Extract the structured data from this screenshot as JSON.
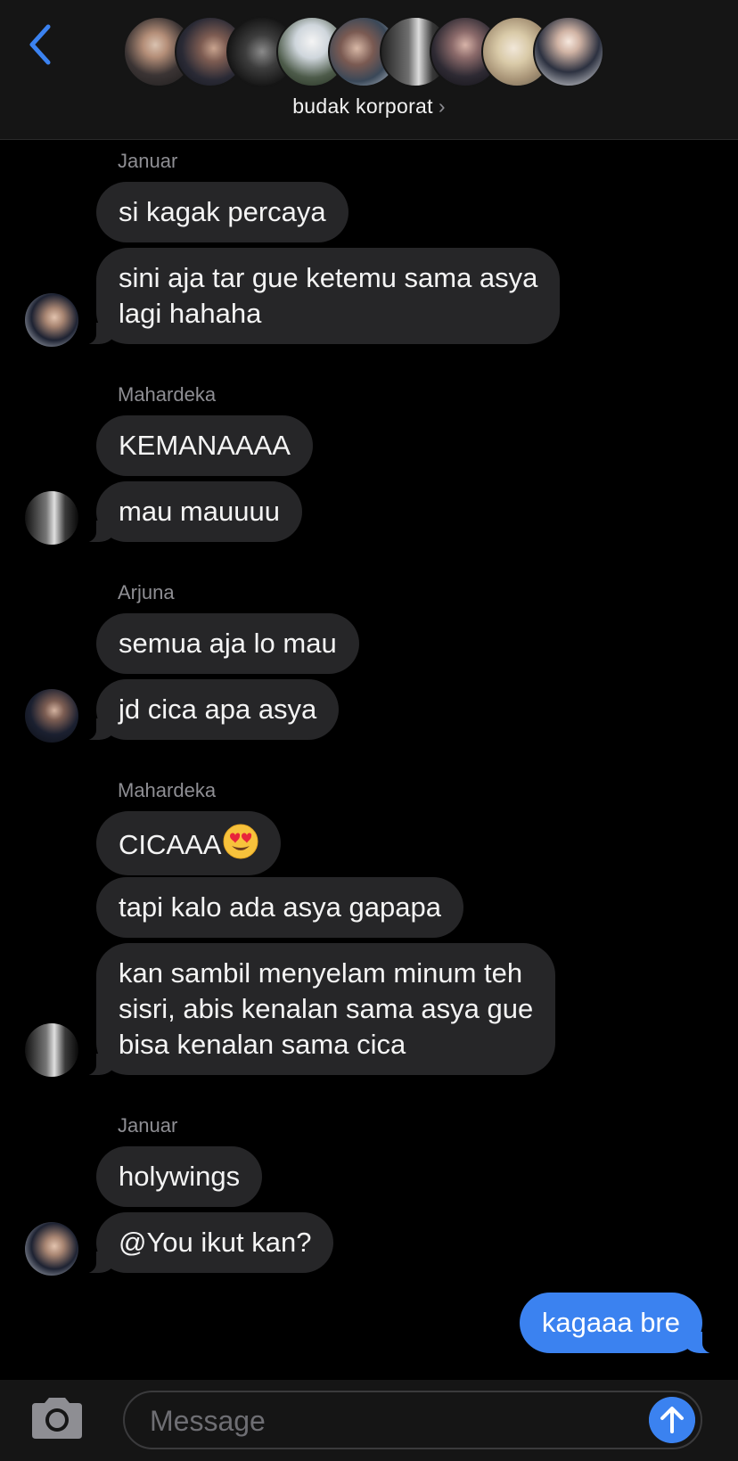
{
  "header": {
    "group_name": "budak korporat",
    "chevron": "›",
    "avatar_count": 9
  },
  "messages": [
    {
      "sender": "Januar",
      "bubbles": [
        "si kagak percaya",
        "sini aja tar gue ketemu sama asya\nlagi hahaha"
      ]
    },
    {
      "sender": "Mahardeka",
      "bubbles": [
        "KEMANAAAA",
        "mau mauuuu"
      ]
    },
    {
      "sender": "Arjuna",
      "bubbles": [
        "semua aja lo mau",
        "jd cica apa asya"
      ]
    },
    {
      "sender": "Mahardeka",
      "bubbles": [
        "CICAAA",
        "tapi kalo ada asya gapapa",
        "kan sambil menyelam minum teh\nsisri, abis kenalan sama asya gue\nbisa kenalan sama cica"
      ]
    },
    {
      "sender": "Januar",
      "bubbles": [
        "holywings",
        "@You ikut kan?"
      ]
    }
  ],
  "my_message": "kagaaa bre",
  "input": {
    "placeholder": "Message"
  },
  "icons": {
    "back": "chevron-left-icon",
    "camera": "camera-icon",
    "send": "arrow-up-icon",
    "emoji": "heart-eyes-emoji"
  },
  "colors": {
    "accent": "#3b82f0",
    "bubble": "#262628",
    "background": "#000000",
    "header": "#151515"
  }
}
